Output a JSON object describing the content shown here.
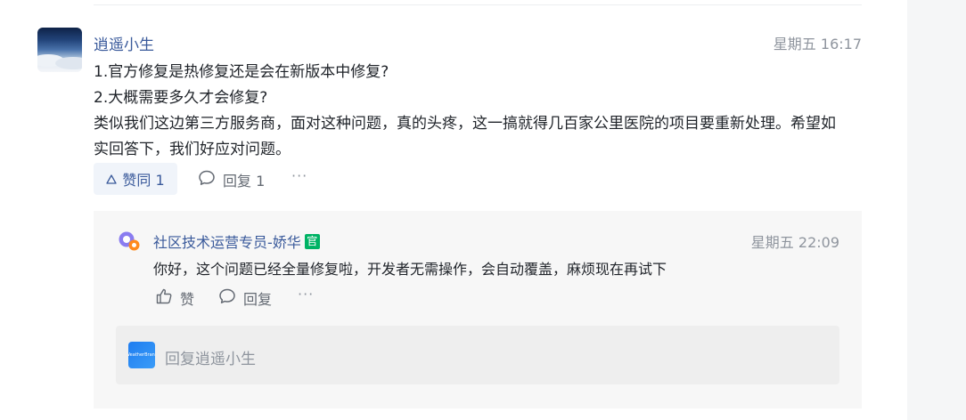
{
  "comment": {
    "author": "逍遥小生",
    "time": "星期五 16:17",
    "lines": [
      "1.官方修复是热修复还是会在新版本中修复?",
      "2.大概需要多久才会修复?",
      "类似我们这边第三方服务商，面对这种问题，真的头疼，这一搞就得几百家公里医院的项目要重新处理。希望如",
      "实回答下，我们好应对问题。"
    ],
    "like_label": "赞同 1",
    "reply_label": "回复 1",
    "more_label": "···"
  },
  "reply": {
    "author": "社区技术运营专员-娇华",
    "badge": "官",
    "time": "星期五 22:09",
    "body": "你好，这个问题已经全量修复啦，开发者无需操作，会自动覆盖，麻烦现在再试下",
    "like_label": "赞",
    "reply_label": "回复",
    "more_label": "···"
  },
  "reply_input": {
    "avatar_text": "WeatherBrand",
    "placeholder": "回复逍遥小生"
  },
  "colors": {
    "link": "#3a5a9b",
    "muted": "#8f959e",
    "badge": "#00b365",
    "panel": "#f7f7f7"
  }
}
